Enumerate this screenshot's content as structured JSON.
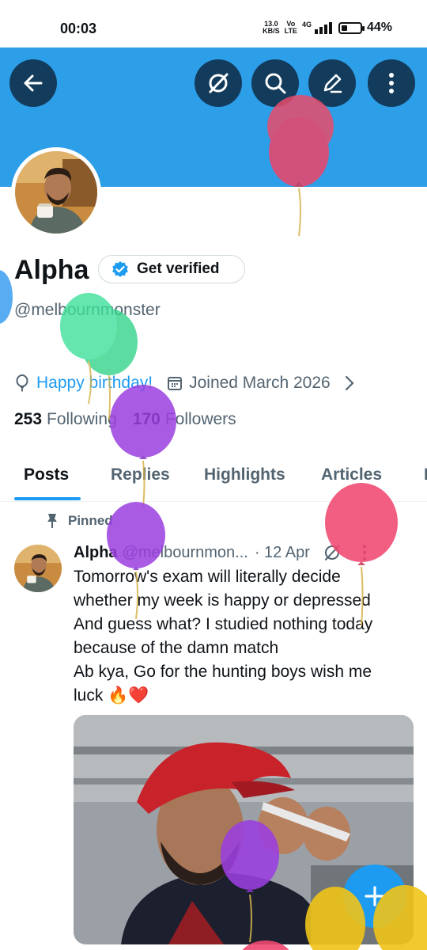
{
  "status_bar": {
    "time": "00:03",
    "speed_value": "13.0",
    "speed_unit": "KB/S",
    "volte_top": "Vo",
    "volte_bottom": "LTE",
    "network": "4G",
    "battery_percent_text": "44%",
    "battery_level": 0.44
  },
  "header": {
    "banner_color": "#2d9ee8",
    "buttons": [
      "back-arrow-icon",
      "grok-icon",
      "search-icon",
      "edit-icon",
      "more-icon"
    ]
  },
  "profile": {
    "name": "Alpha",
    "verify_label": "Get verified",
    "handle": "@melbournmonster",
    "birthday_text": "Happy birthday!",
    "joined_text": "Joined March 2026",
    "following_count": "253",
    "following_label": "Following",
    "followers_count": "170",
    "followers_label": "Followers"
  },
  "tabs": [
    {
      "label": "Posts",
      "active": true
    },
    {
      "label": "Replies",
      "active": false
    },
    {
      "label": "Highlights",
      "active": false
    },
    {
      "label": "Articles",
      "active": false
    },
    {
      "label": "M",
      "active": false
    }
  ],
  "post": {
    "pinned_label": "Pinned",
    "author": "Alpha",
    "handle": "@melbournmon...",
    "time": "· 12 Apr",
    "lines": [
      "Tomorrow's exam will literally decide",
      "whether my week is happy or depressed",
      "And guess what? I studied nothing today",
      "because of the damn match",
      "Ab kya, Go for the hunting boys wish me",
      "luck 🔥❤️"
    ]
  },
  "colors": {
    "accent": "#1d9bf0",
    "dark_button": "#123b5c",
    "secondary_text": "#536471"
  }
}
